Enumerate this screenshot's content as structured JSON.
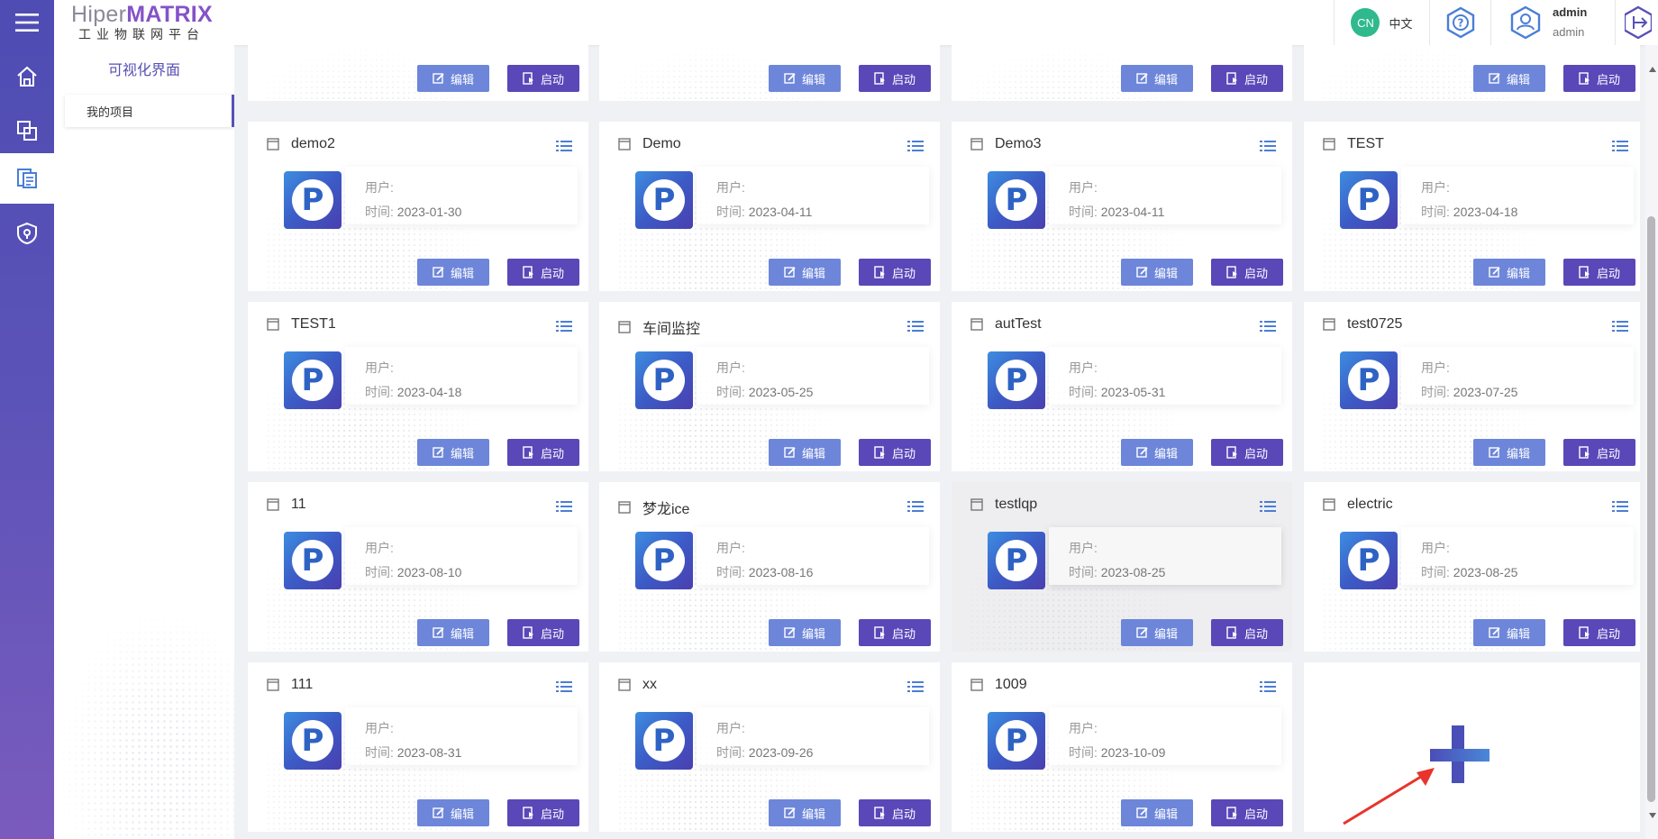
{
  "brand": {
    "prefix": "Hiper",
    "name": "MATRIX",
    "subtitle": "工业物联网平台"
  },
  "header": {
    "lang_badge": "CN",
    "lang_label": "中文",
    "help_icon": "help-hexagon-icon",
    "user_name": "admin",
    "user_role": "admin"
  },
  "rail": {
    "items": [
      "home-icon",
      "devices-icon",
      "visualization-icon",
      "security-icon"
    ],
    "active": "visualization-icon"
  },
  "sidebar": {
    "title": "可视化界面",
    "items": [
      {
        "label": "我的项目"
      }
    ]
  },
  "labels": {
    "user": "用户:",
    "time": "时间:",
    "edit": "编辑",
    "start": "启动"
  },
  "projects": [
    {
      "name": "",
      "user": "",
      "time": ""
    },
    {
      "name": "",
      "user": "",
      "time": ""
    },
    {
      "name": "",
      "user": "",
      "time": ""
    },
    {
      "name": "",
      "user": "",
      "time": ""
    },
    {
      "name": "demo2",
      "user": "",
      "time": "2023-01-30"
    },
    {
      "name": "Demo",
      "user": "",
      "time": "2023-04-11"
    },
    {
      "name": "Demo3",
      "user": "",
      "time": "2023-04-11"
    },
    {
      "name": "TEST",
      "user": "",
      "time": "2023-04-18"
    },
    {
      "name": "TEST1",
      "user": "",
      "time": "2023-04-18"
    },
    {
      "name": "车间监控",
      "user": "",
      "time": "2023-05-25"
    },
    {
      "name": "autTest",
      "user": "",
      "time": "2023-05-31"
    },
    {
      "name": "test0725",
      "user": "",
      "time": "2023-07-25"
    },
    {
      "name": "11",
      "user": "",
      "time": "2023-08-10"
    },
    {
      "name": "梦龙ice",
      "user": "",
      "time": "2023-08-16"
    },
    {
      "name": "testlqp",
      "user": "",
      "time": "2023-08-25"
    },
    {
      "name": "electric",
      "user": "",
      "time": "2023-08-25"
    },
    {
      "name": "111",
      "user": "",
      "time": "2023-08-31"
    },
    {
      "name": "xx",
      "user": "",
      "time": "2023-09-26"
    },
    {
      "name": "1009",
      "user": "",
      "time": "2023-10-09"
    }
  ],
  "hovered_project": "testlqp",
  "colors": {
    "primary": "#5a47b8",
    "edit_button": "#6d86da",
    "rail": "#4f4db3",
    "brand_accent": "#8552c8",
    "lang_badge": "#2fb98c"
  }
}
